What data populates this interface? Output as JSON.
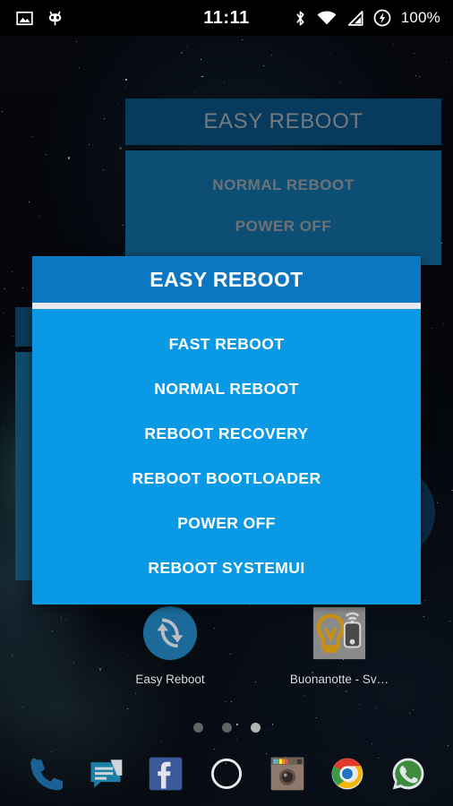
{
  "status_bar": {
    "time": "11:11",
    "battery": "100%",
    "left_icons": [
      {
        "name": "screenshot-image-icon"
      },
      {
        "name": "cyanogenmod-icon"
      }
    ],
    "right_icons": [
      {
        "name": "bluetooth-icon"
      },
      {
        "name": "wifi-icon"
      },
      {
        "name": "cellular-signal-icon"
      },
      {
        "name": "battery-charging-icon"
      }
    ]
  },
  "background_widget": {
    "title": "EASY REBOOT",
    "items": [
      {
        "label": "NORMAL REBOOT"
      },
      {
        "label": "POWER OFF"
      }
    ]
  },
  "dialog": {
    "title": "EASY REBOOT",
    "items": [
      {
        "label": "FAST REBOOT"
      },
      {
        "label": "NORMAL REBOOT"
      },
      {
        "label": "REBOOT RECOVERY"
      },
      {
        "label": "REBOOT BOOTLOADER"
      },
      {
        "label": "POWER OFF"
      },
      {
        "label": "REBOOT SYSTEMUI"
      }
    ],
    "header_color": "#0b77c2",
    "body_color": "#0a9ae5",
    "text_color": "#ffffff"
  },
  "home_screen": {
    "apps": [
      {
        "label": "Easy Reboot",
        "icon": "sync-refresh-icon"
      },
      {
        "label": "Buonanotte  - Sv…",
        "icon": "lightbulb-phone-icon"
      }
    ],
    "page_indicator": {
      "count": 3,
      "active": 3
    }
  },
  "dock": {
    "items": [
      {
        "name": "phone-icon"
      },
      {
        "name": "messaging-icon"
      },
      {
        "name": "facebook-icon"
      },
      {
        "name": "app-drawer-icon"
      },
      {
        "name": "instagram-icon"
      },
      {
        "name": "chrome-icon"
      },
      {
        "name": "whatsapp-icon"
      }
    ]
  }
}
